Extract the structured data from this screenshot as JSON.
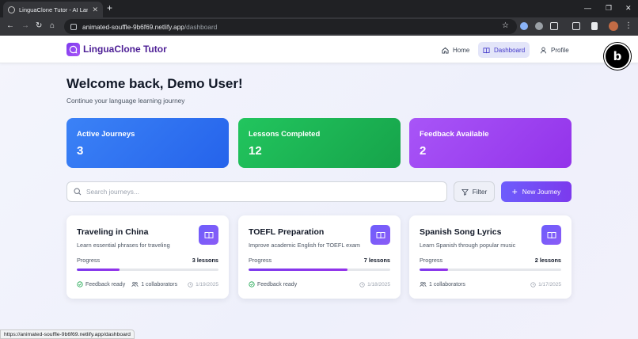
{
  "browser": {
    "tab_title": "LinguaClone Tutor - AI Language",
    "url_host": "animated-souffle-9b6f69.netlify.app",
    "url_path": "/dashboard",
    "status_url": "https://animated-souffle-9b6f69.netlify.app/dashboard"
  },
  "app": {
    "logo_text": "LinguaClone Tutor",
    "nav": {
      "home": "Home",
      "dashboard": "Dashboard",
      "profile": "Profile"
    }
  },
  "header": {
    "welcome": "Welcome back, Demo User!",
    "subtitle": "Continue your language learning journey"
  },
  "stats": [
    {
      "label": "Active Journeys",
      "value": "3"
    },
    {
      "label": "Lessons Completed",
      "value": "12"
    },
    {
      "label": "Feedback Available",
      "value": "2"
    }
  ],
  "search": {
    "placeholder": "Search journeys..."
  },
  "buttons": {
    "filter": "Filter",
    "new_journey": "New Journey"
  },
  "journeys": [
    {
      "title": "Traveling in China",
      "description": "Learn essential phrases for traveling",
      "progress_label": "Progress",
      "lessons": "3 lessons",
      "progress": 0.3,
      "feedback": "Feedback ready",
      "collaborators": "1 collaborators",
      "date": "1/19/2025"
    },
    {
      "title": "TOEFL Preparation",
      "description": "Improve academic English for TOEFL exam",
      "progress_label": "Progress",
      "lessons": "7 lessons",
      "progress": 0.7,
      "feedback": "Feedback ready",
      "collaborators": "",
      "date": "1/18/2025"
    },
    {
      "title": "Spanish Song Lyrics",
      "description": "Learn Spanish through popular music",
      "progress_label": "Progress",
      "lessons": "2 lessons",
      "progress": 0.2,
      "feedback": "",
      "collaborators": "1 collaborators",
      "date": "1/17/2025"
    }
  ],
  "colors": {
    "accent": "#7c3aed",
    "stat_blue": "#3b82f6",
    "stat_green": "#22c55e",
    "stat_purple": "#a855f7",
    "success": "#16a34a"
  }
}
